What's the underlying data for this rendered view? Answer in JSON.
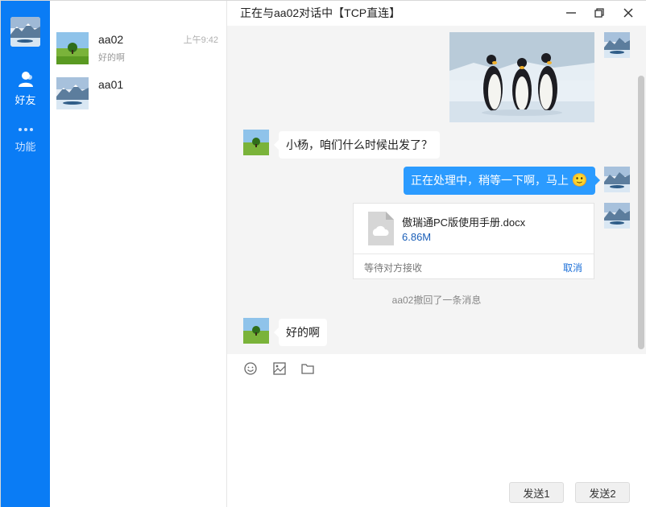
{
  "window": {
    "title": "正在与aa02对话中【TCP直连】"
  },
  "nav": {
    "items": [
      {
        "label": "好友",
        "icon": "user-icon"
      },
      {
        "label": "功能",
        "icon": "more-dots-icon"
      }
    ]
  },
  "contacts": [
    {
      "name": "aa02",
      "preview": "好的啊",
      "time": "上午9:42"
    },
    {
      "name": "aa01",
      "preview": "",
      "time": ""
    }
  ],
  "messages": {
    "m1_text": "小杨，咱们什么时候出发了？",
    "m2_text": "正在处理中，稍等一下啊，马上",
    "m2_emoji": "🙂",
    "file": {
      "name": "傲瑞通PC版使用手册.docx",
      "size": "6.86M",
      "status": "等待对方接收",
      "cancel_label": "取消"
    },
    "system_note": "aa02撤回了一条消息",
    "m4_text": "好的啊"
  },
  "composer": {
    "placeholder": "",
    "send1_label": "发送1",
    "send2_label": "发送2"
  },
  "colors": {
    "nav_bg": "#0a7cf5",
    "bubble_right": "#2b9bff",
    "link": "#1b6fd8"
  }
}
